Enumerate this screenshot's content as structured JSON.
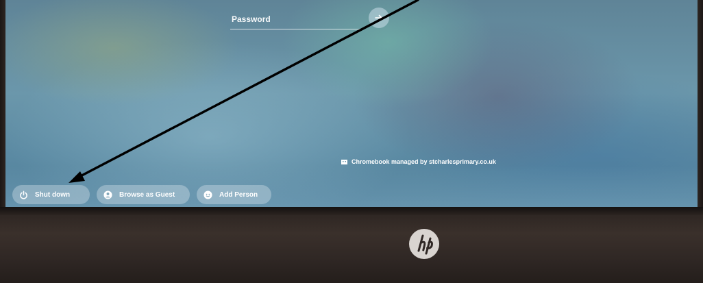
{
  "login": {
    "password_placeholder": "Password",
    "submit_icon": "arrow-right-icon"
  },
  "managed_notice": {
    "icon": "building-icon",
    "text": "Chromebook managed by stcharlesprimary.co.uk"
  },
  "shelf": {
    "buttons": [
      {
        "label": "Shut down",
        "icon": "power-icon"
      },
      {
        "label": "Browse as Guest",
        "icon": "guest-person-icon"
      },
      {
        "label": "Add Person",
        "icon": "add-person-icon"
      }
    ]
  },
  "device": {
    "logo": "hp-logo-icon"
  },
  "annotation": {
    "type": "arrow",
    "color": "#000000",
    "points_to": "shut-down-button"
  },
  "colors": {
    "wallpaper_base": "#6b97ab",
    "pill_bg": "rgba(225,235,242,0.35)",
    "bezel": "#2f2724",
    "text": "#ffffff"
  }
}
